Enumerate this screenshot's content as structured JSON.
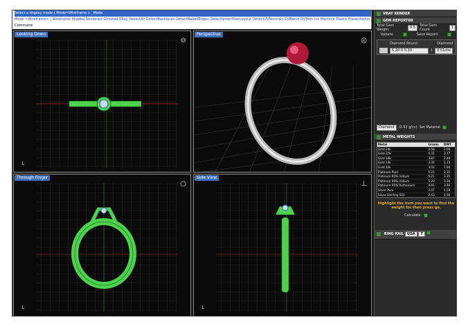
{
  "command": {
    "line1": "Select a display mode ( Mode=Wireframe ): _Mode",
    "line2": "Mode <Wireframe> ( Wireframe  Shaded  Rendered  Ghosted  XRay  DetectAll  DetectBacklaces  DetectNakedEdges  DetectSmartPearLayout  DetectUVNormals  GVBlend  GVTech  Ice  Machine  Plastic  Presentation",
    "line3": "Command:"
  },
  "viewports": [
    {
      "title": "Looking Down",
      "icon": "ring-side-icon"
    },
    {
      "title": "Perspective",
      "icon": "ring-top-icon"
    },
    {
      "title": "Through Finger",
      "icon": "ring-front-icon"
    },
    {
      "title": "Side View",
      "icon": "ring-side-view-icon"
    }
  ],
  "panel": {
    "vray_title": "VRAY RENDER",
    "gem_title": "GEM REPORTER",
    "total_gem_weight_label": "Total Gem Weight",
    "total_gem_weight_value": "0.5",
    "total_gem_count_label": "Total Gem Count",
    "total_gem_count_value": "1",
    "update_label": "Update",
    "save_report_label": "Save Report",
    "gem_col1": "Diamond Round",
    "gem_col2": "Diamond",
    "gem_size": "5.20 X 5.20",
    "gem_count": "1",
    "gem_weight": "0.51ctw",
    "material_select": "Diamond",
    "material_value": "(3.52 g/cc)",
    "set_material_label": "Set Material",
    "metal_title": "METAL WEIGHTS",
    "metal_headers": [
      "Metal",
      "Grams",
      "DWT"
    ],
    "metals": [
      [
        "Gold 24k",
        "4.58",
        "2.94"
      ],
      [
        "Gold 22k",
        "4.31",
        "2.77"
      ],
      [
        "Gold 18k",
        "3.87",
        "2.49"
      ],
      [
        "Gold 14k",
        "3.34",
        "2.15"
      ],
      [
        "Gold 10k",
        "3.02",
        "1.94"
      ],
      [
        "Platinum Pure",
        "5.21",
        "3.35"
      ],
      [
        "Platinum 95% Iridium",
        "5.21",
        "3.35"
      ],
      [
        "Platinum 90% Iridium",
        "5.20",
        "3.34"
      ],
      [
        "Platinum 95% Ruthenium",
        "4.91",
        "3.16"
      ],
      [
        "Silver Pure",
        "2.47",
        "1.59"
      ],
      [
        "Silver Sterling 925",
        "2.43",
        "1.56"
      ]
    ],
    "metal_note": "Highlight the item you want to find the weight for then press go.",
    "calculate_label": "Calculate:",
    "ring_title": "RING",
    "ring_sub": "RAIL",
    "ring_region": "USA",
    "ring_size": "7"
  }
}
